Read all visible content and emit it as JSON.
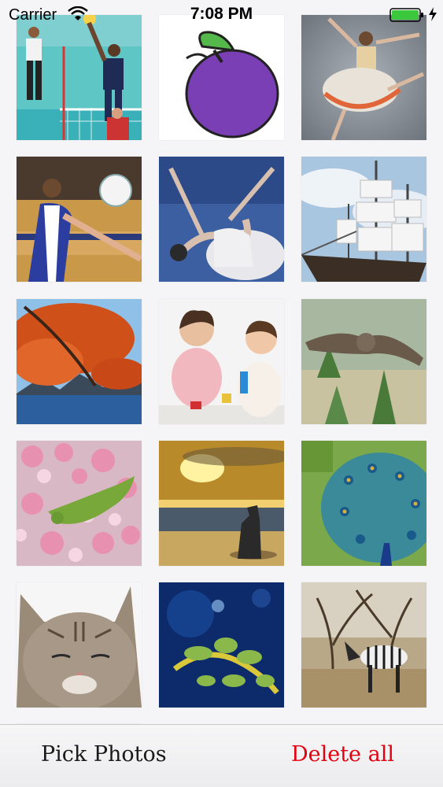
{
  "status_bar": {
    "carrier": "Carrier",
    "time": "7:08 PM",
    "battery_color": "#3cc83c"
  },
  "photos": [
    {
      "name": "photo-volleyball-spike",
      "subject": "volleyball players at net"
    },
    {
      "name": "photo-plum-drawing",
      "subject": "plum cartoon drawing"
    },
    {
      "name": "photo-ballerina-leap",
      "subject": "ballerina leaping"
    },
    {
      "name": "photo-volleyball-dig",
      "subject": "volleyball player reaching for ball"
    },
    {
      "name": "photo-dancer-pose",
      "subject": "dancer in white dress"
    },
    {
      "name": "photo-tall-ship",
      "subject": "sailing ship with white sails"
    },
    {
      "name": "photo-autumn-lake",
      "subject": "red autumn tree over lake"
    },
    {
      "name": "photo-babies-playing",
      "subject": "two babies playing"
    },
    {
      "name": "photo-owl-flying",
      "subject": "owl in flight"
    },
    {
      "name": "photo-bird-blossoms",
      "subject": "green bird among pink blossoms"
    },
    {
      "name": "photo-dog-sunset",
      "subject": "dog on beach at sunset"
    },
    {
      "name": "photo-peacock",
      "subject": "peacock displaying feathers"
    },
    {
      "name": "photo-tabby-cat",
      "subject": "tabby cat with eyes closed"
    },
    {
      "name": "photo-sea-dragon",
      "subject": "leafy sea dragon"
    },
    {
      "name": "photo-zebra",
      "subject": "zebra in savanna"
    }
  ],
  "toolbar": {
    "pick_label": "Pick Photos",
    "delete_label": "Delete all",
    "delete_color": "#e3000f"
  }
}
